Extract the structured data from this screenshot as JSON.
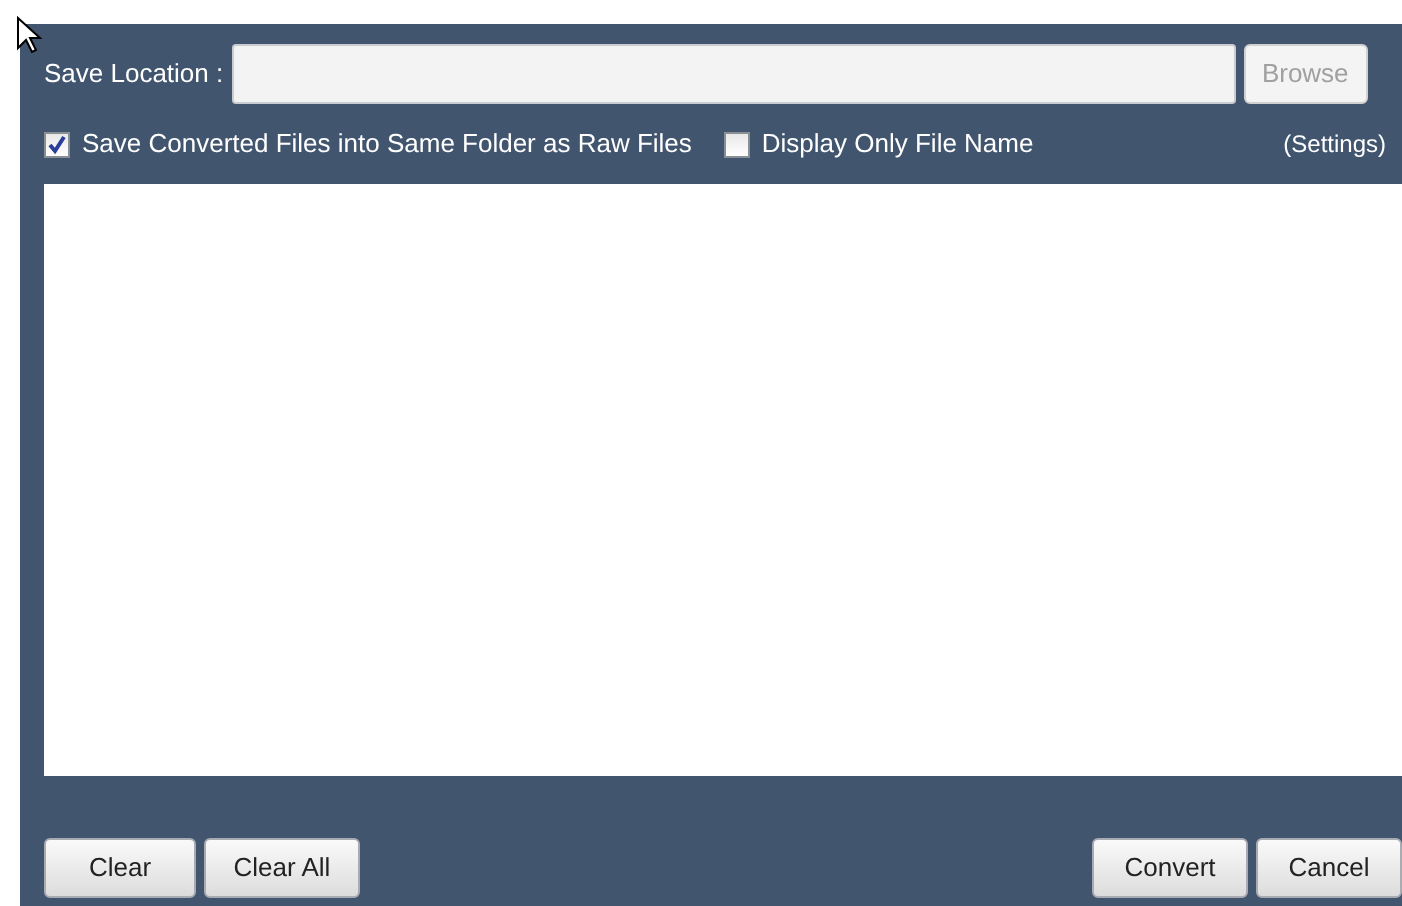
{
  "save_location": {
    "label": "Save Location :",
    "browse": {
      "label": "Browse",
      "disabled": true
    }
  },
  "options": [
    {
      "label": "Save Converted Files into Same Folder as Raw Files",
      "checked": true
    },
    {
      "label": "Display Only File Name",
      "checked": false
    }
  ],
  "settings_link": "(Settings)",
  "left_buttons": [
    "Clear",
    "Clear All"
  ],
  "right_buttons": [
    "Convert",
    "Cancel"
  ]
}
